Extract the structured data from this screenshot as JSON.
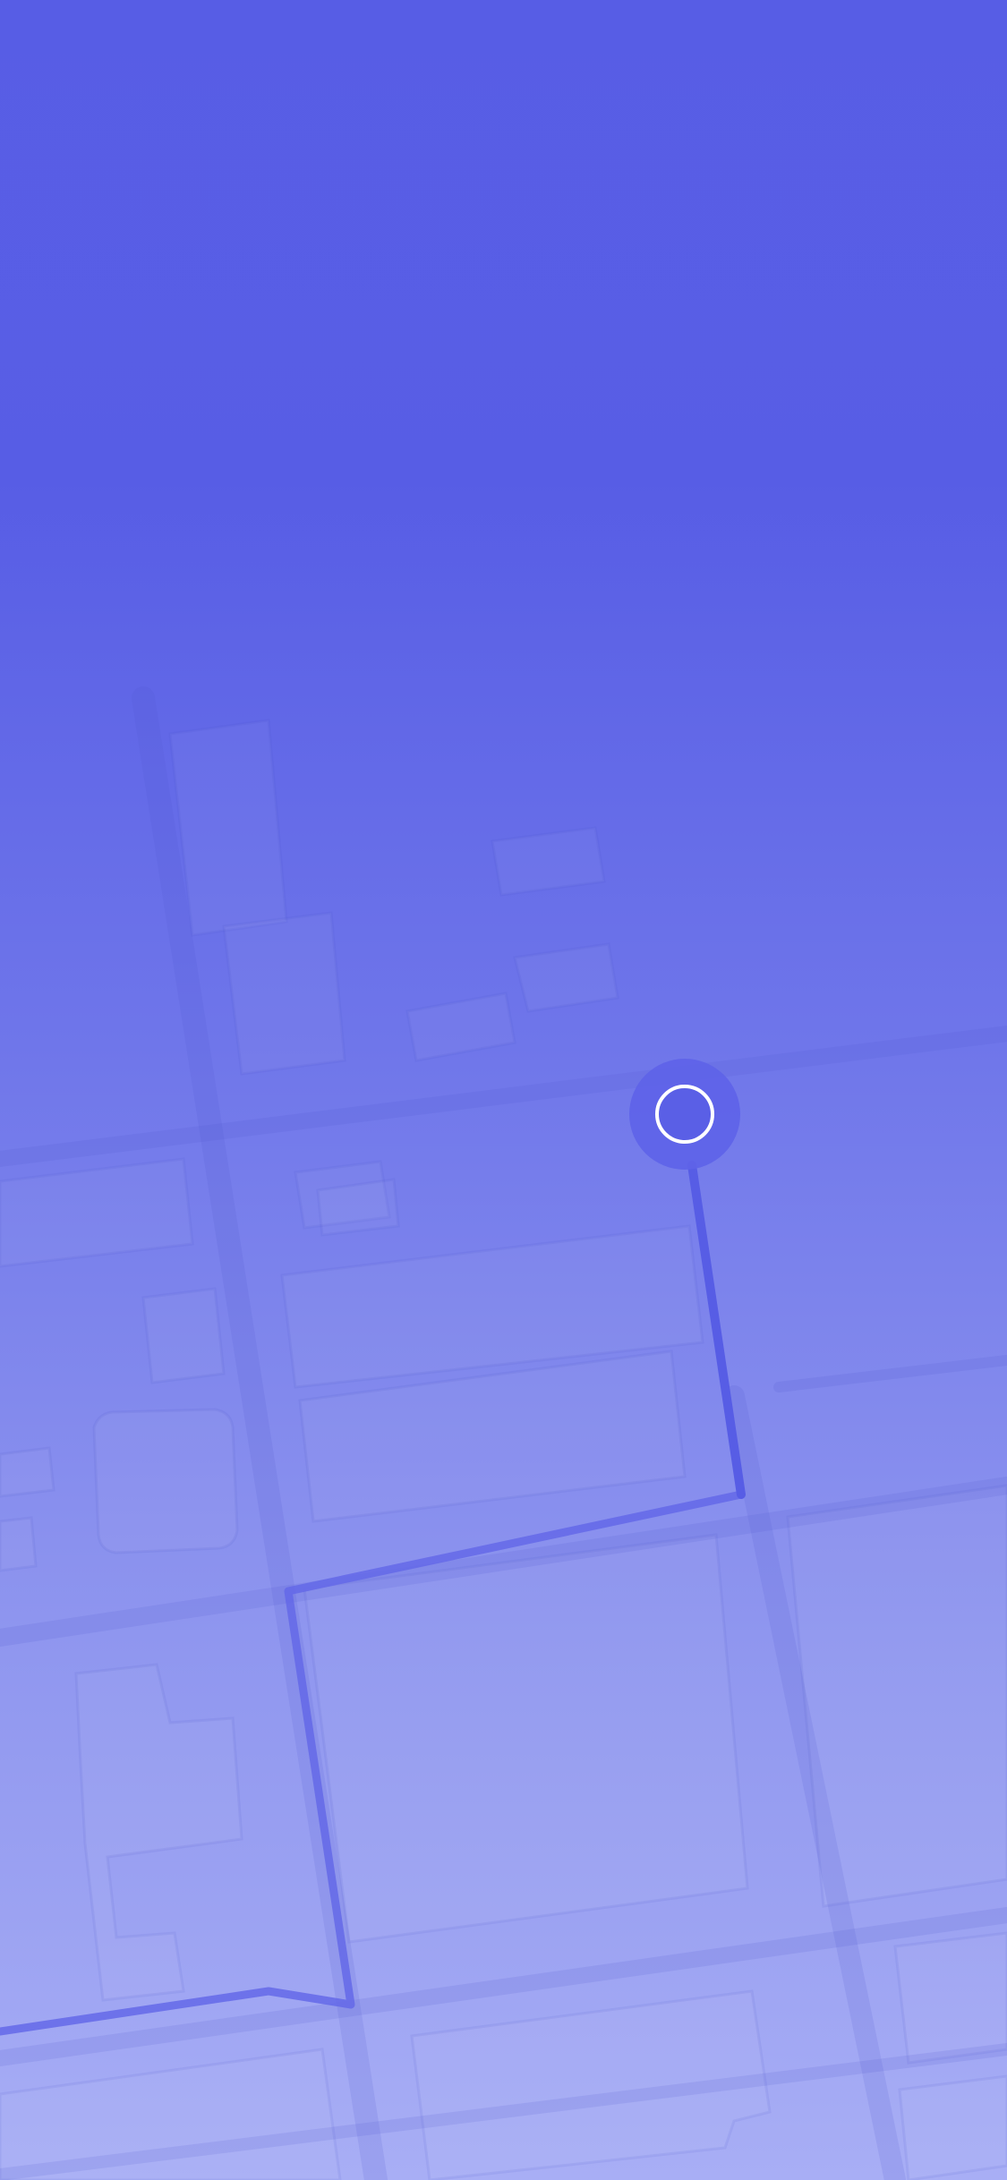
{
  "screen": {
    "title": ""
  },
  "map": {
    "background_top": "#575de5",
    "background_bottom": "#a8aef5",
    "route_color": "#5a5fe6",
    "marker_fill": "#5e63e8",
    "marker_ring": "#ffffff"
  },
  "current_location": {
    "marker": "location-pin-icon"
  }
}
